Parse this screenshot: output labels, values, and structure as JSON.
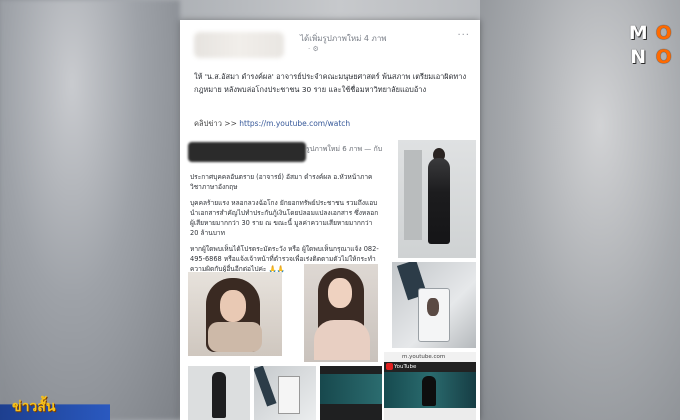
{
  "post": {
    "header_text": "ได้เพิ่มรูปภาพใหม่ 4 ภาพ",
    "header_meta": "· ⚙",
    "more_icon": "···",
    "caption": "ให้ 'น.ส.อัสมา ดำรงค์ผล' อาจารย์ประจำคณะมนุษยศาสตร์ พ้นสภาพ เตรียมเอาผิดทางกฎหมาย หลังพบล่อโกงประชาชน 30 ราย และใช้ชื่อมหาวิทยาลัยแอบอ้าง",
    "clip_label": "คลิปข่าว >>",
    "clip_url": "https://m.youtube.com/watch"
  },
  "shared": {
    "head_text": "รูปภาพใหม่ 6 ภาพ — กับ",
    "para1": "ประกาศบุคคลอันตราย (อาจารย์) อัสมา ดำรงค์ผล อ.หัวหน้าภาควิชาภาษาอังกฤษ",
    "para2": "บุคคลร้ายแรง หลอกลวงฉ้อโกง ยักยอกทรัพย์ประชาชน รวมถึงแอบนำเอกสารสำคัญไปทำประกันกู้เงินโดยปลอมแปลงเอกสาร ซึ่งหลอกผู้เสียหายมากกว่า 30 ราย ณ ขณะนี้ มูลค่าความเสียหายมากกว่า 20 ล้านบาท",
    "para3": "หากผู้ใดพบเห็นได้โปรดระมัดระวัง หรือ ผู้ใดพบเห็นกรุณาแจ้ง 082-495-6868 หรือแจ้งเจ้าหน้าที่ตำรวจเพื่อเร่งติดตามตัวไม่ให้กระทำความผิดกับผู้อื่นอีกต่อไปค่ะ 🙏🙏"
  },
  "yt": {
    "url": "m.youtube.com",
    "bar": "YouTube"
  },
  "logo": {
    "letters": [
      "M",
      "O",
      "N",
      "O"
    ]
  },
  "ticker": {
    "text": "ข่าวสั้น"
  }
}
